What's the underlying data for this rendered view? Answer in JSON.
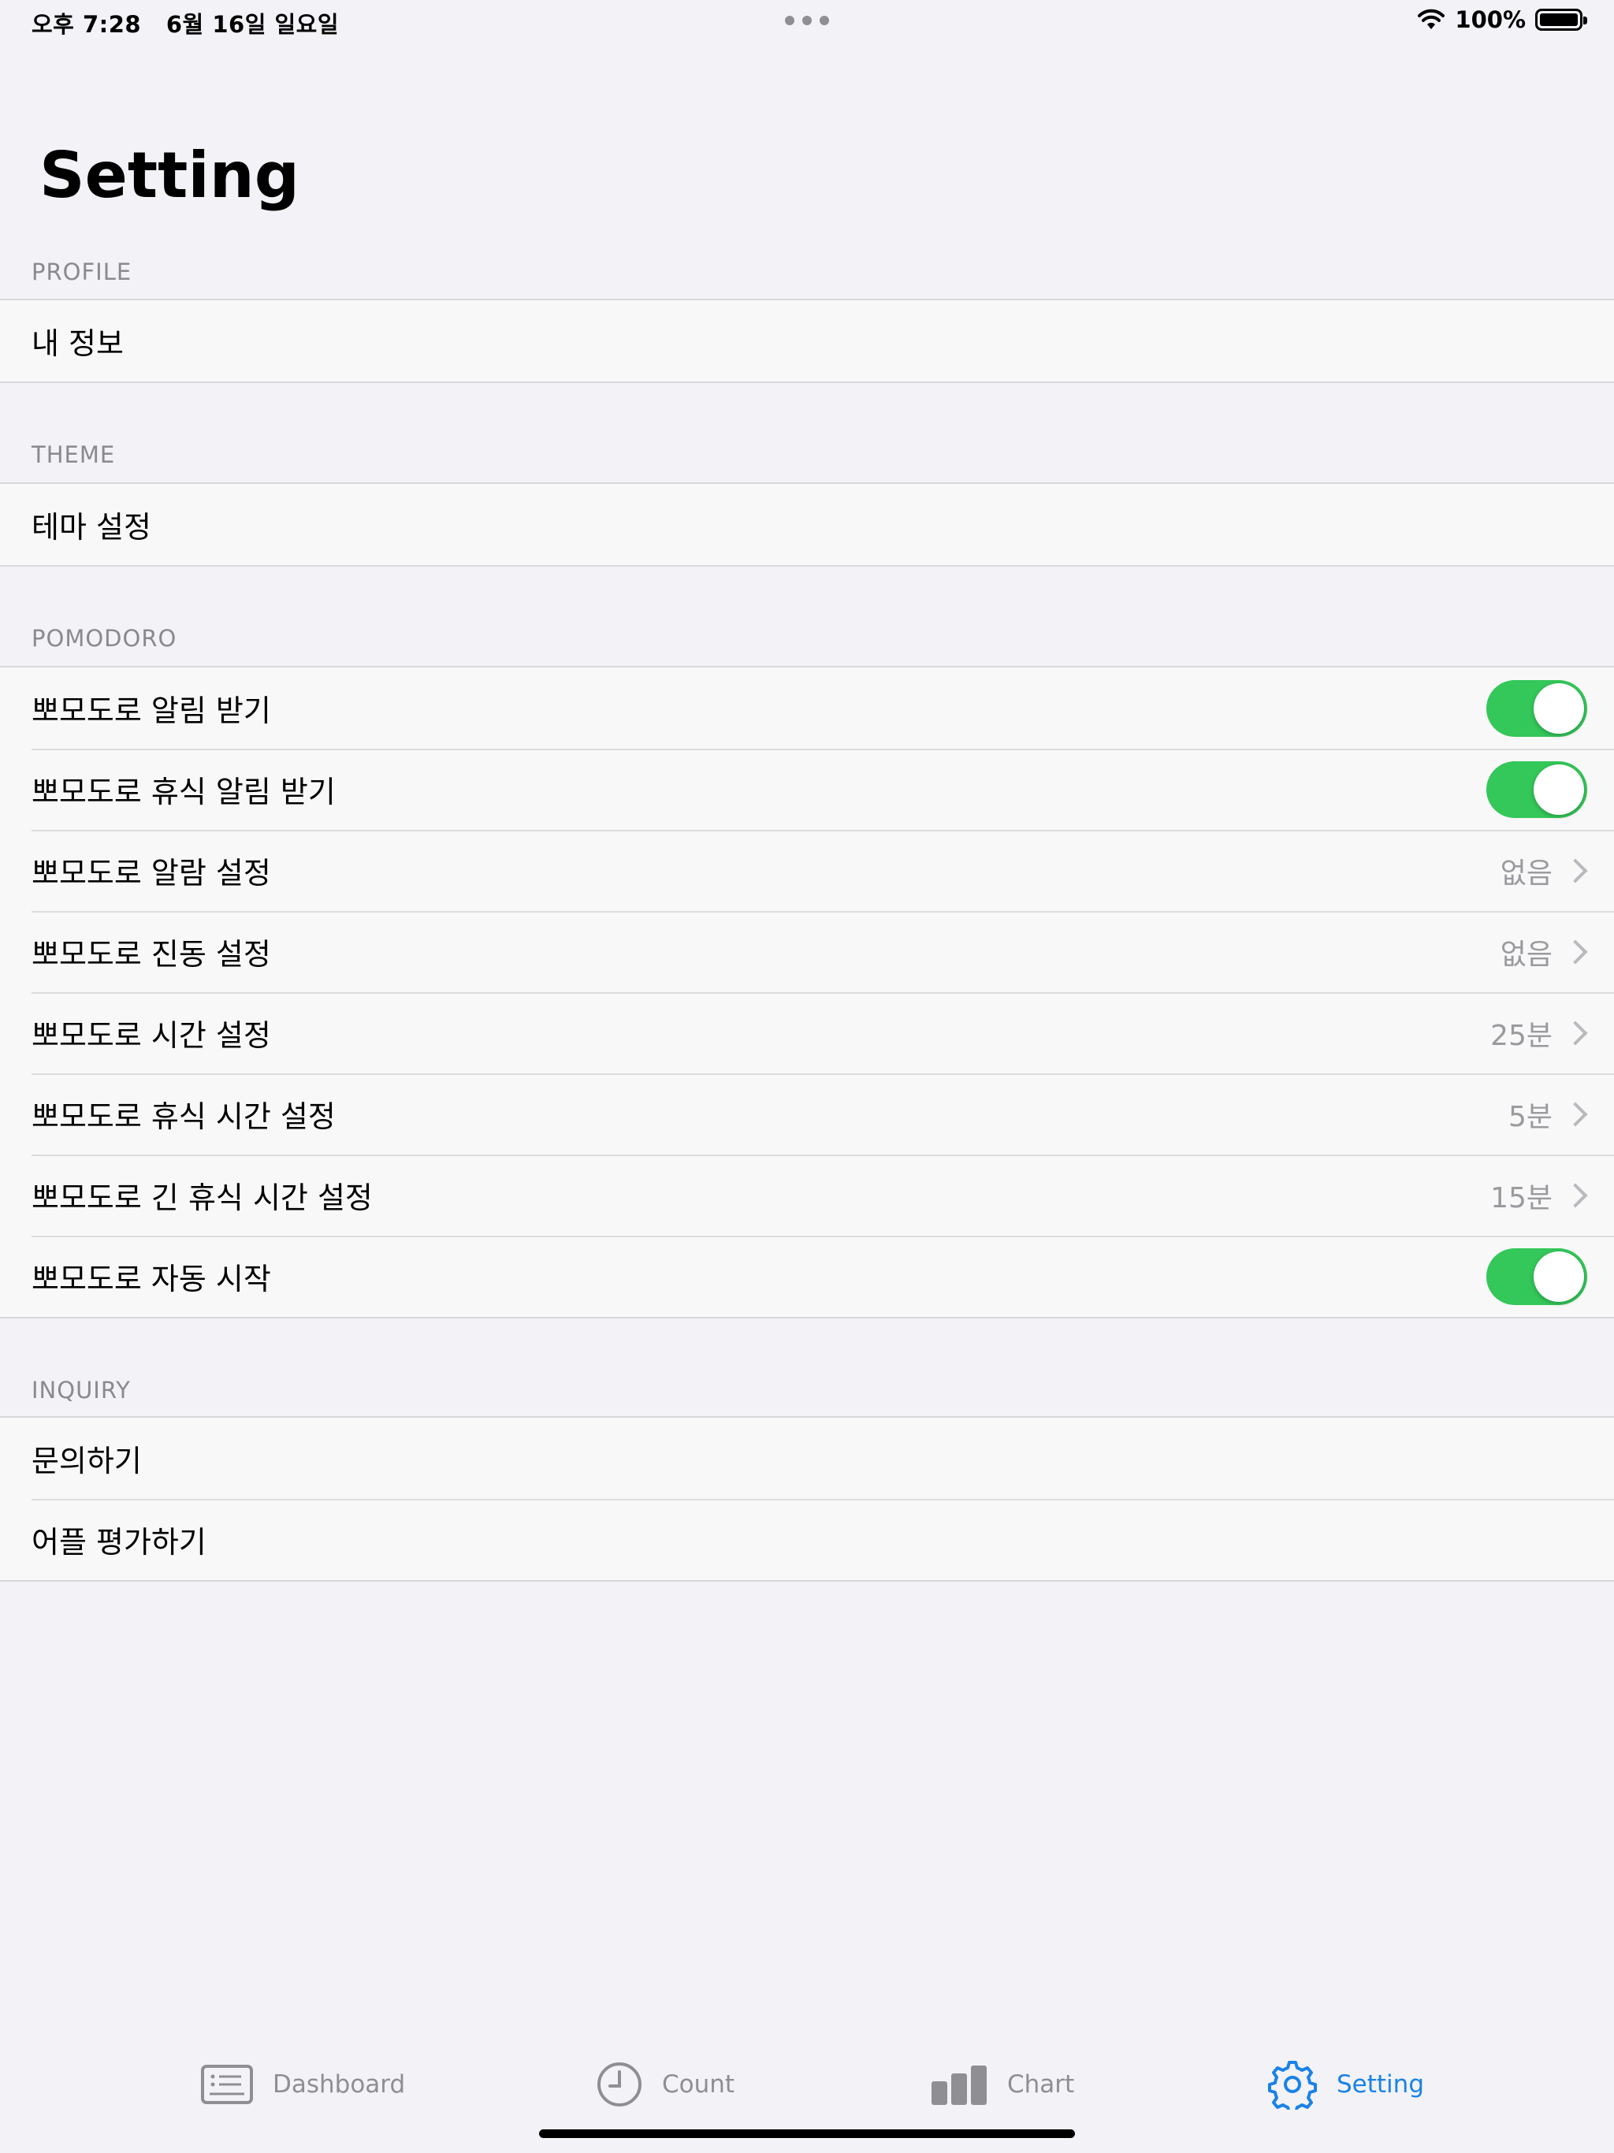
{
  "status_bar": {
    "time_date": "오후 7:28   6월 16일 일요일",
    "battery": "100%",
    "battery_level": 1.0
  },
  "page_title": "Setting",
  "sections": {
    "profile": {
      "header": "PROFILE",
      "rows": [
        {
          "label": "내 정보"
        }
      ]
    },
    "theme": {
      "header": "THEME",
      "rows": [
        {
          "label": "테마 설정"
        }
      ]
    },
    "pomodoro": {
      "header": "POMODORO",
      "rows": [
        {
          "label": "뽀모도로 알림 받기",
          "toggle": true
        },
        {
          "label": "뽀모도로 휴식 알림 받기",
          "toggle": true
        },
        {
          "label": "뽀모도로 알람 설정",
          "value": "없음"
        },
        {
          "label": "뽀모도로 진동 설정",
          "value": "없음"
        },
        {
          "label": "뽀모도로 시간 설정",
          "value": "25분"
        },
        {
          "label": "뽀모도로 휴식 시간 설정",
          "value": "5분"
        },
        {
          "label": "뽀모도로 긴 휴식 시간 설정",
          "value": "15분"
        },
        {
          "label": "뽀모도로 자동 시작",
          "toggle": true
        }
      ]
    },
    "inquiry": {
      "header": "INQUIRY",
      "rows": [
        {
          "label": "문의하기"
        },
        {
          "label": "어플 평가하기"
        }
      ]
    }
  },
  "tab_bar": {
    "tabs": [
      {
        "label": "Dashboard",
        "icon": "dashboard-icon",
        "active": false
      },
      {
        "label": "Count",
        "icon": "clock-icon",
        "active": false
      },
      {
        "label": "Chart",
        "icon": "bar-chart-icon",
        "active": false
      },
      {
        "label": "Setting",
        "icon": "gear-icon",
        "active": true
      }
    ]
  },
  "colors": {
    "accent": "#1a82e6",
    "toggle_on": "#34c759",
    "background": "#f2f2f7"
  }
}
